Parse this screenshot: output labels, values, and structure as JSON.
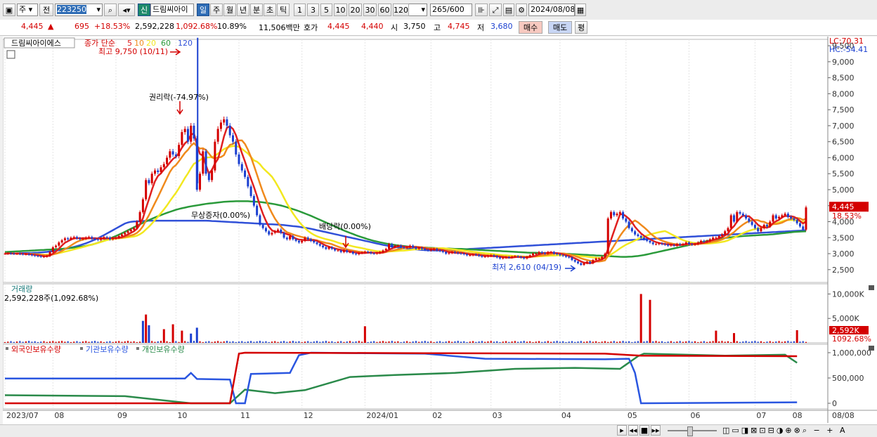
{
  "toolbar": {
    "market": "주",
    "prev_label": "전",
    "code": "223250",
    "credit_badge": "신",
    "name": "드림씨아이",
    "period_tabs": [
      "일",
      "주",
      "월",
      "년",
      "분",
      "초",
      "틱"
    ],
    "period_selected": "일",
    "interval_buttons": [
      "1",
      "3",
      "5",
      "10",
      "20",
      "30",
      "60",
      "120"
    ],
    "count": "265",
    "count_max": "/600",
    "date": "2024/08/08"
  },
  "quote": {
    "price": "4,445",
    "change": "695",
    "change_pct": "+18.53%",
    "volume": "2,592,228",
    "volume_ratio": "1,092.68%",
    "turnover": "10.89%",
    "amount": "11,506백만",
    "ask_label": "호가",
    "ask1": "4,445",
    "ask2": "4,440",
    "open_label": "시",
    "open": "3,750",
    "high_label": "고",
    "high": "4,745",
    "low_label": "저",
    "low": "3,680",
    "buy_label": "매수",
    "sell_label": "매도",
    "avg_label": "평"
  },
  "chart_data": [
    {
      "type": "line",
      "panel": "price",
      "title_label": "드림씨아이에스",
      "ma_label": "종가 단순",
      "ma_periods": [
        "5",
        "10",
        "20",
        "60",
        "120"
      ],
      "ma_colors": [
        "#e02020",
        "#f08a1c",
        "#f2e820",
        "#2a9a3a",
        "#3050d8"
      ],
      "lc": "LC:70.31",
      "hc": "HC:-54.41",
      "y_ticks": [
        "9,500",
        "9,000",
        "8,500",
        "8,000",
        "7,500",
        "7,000",
        "6,500",
        "6,000",
        "5,500",
        "5,000",
        "4,500",
        "4,000",
        "3,500",
        "3,000",
        "2,500"
      ],
      "ylim": [
        2100,
        9700
      ],
      "x_ticks": [
        "2023/07",
        "08",
        "09",
        "10",
        "11",
        "12",
        "2024/01",
        "02",
        "03",
        "04",
        "05",
        "06",
        "07",
        "08",
        "08/08"
      ],
      "last_price_label": "4,445",
      "last_change_label": "18.53%",
      "annotations": [
        "최고 9,750 (10/11)",
        "권리락(-74.97%)",
        "무상증자(0.00%)",
        "배당락(0.00%)",
        "최저 2,610 (04/19)"
      ],
      "close": [
        3000,
        3010,
        3005,
        2995,
        3000,
        2990,
        2980,
        2985,
        2970,
        2950,
        2930,
        2920,
        2900,
        2910,
        2930,
        3050,
        3200,
        3250,
        3350,
        3420,
        3480,
        3450,
        3500,
        3520,
        3480,
        3450,
        3470,
        3500,
        3520,
        3470,
        3450,
        3430,
        3480,
        3520,
        3500,
        3450,
        3480,
        3500,
        3550,
        3600,
        3650,
        3700,
        3750,
        3800,
        4000,
        4300,
        4700,
        5300,
        5200,
        5500,
        5600,
        5550,
        5700,
        5800,
        6000,
        6200,
        6100,
        6050,
        6400,
        6800,
        6900,
        6500,
        7000,
        6600,
        5000,
        5500,
        6200,
        5500,
        5300,
        5600,
        6500,
        6900,
        7100,
        7200,
        7000,
        6700,
        6500,
        6100,
        5800,
        5600,
        5400,
        5100,
        4800,
        4500,
        4200,
        3900,
        3800,
        3700,
        3600,
        3650,
        3700,
        3750,
        3650,
        3500,
        3450,
        3550,
        3450,
        3400,
        3350,
        3400,
        3500,
        3450,
        3400,
        3350,
        3300,
        3250,
        3200,
        3150,
        3200,
        3150,
        3100,
        3100,
        3050,
        3100,
        3050,
        3050,
        3000,
        2980,
        3020,
        3040,
        3060,
        3040,
        3010,
        3000,
        3020,
        3050,
        3100,
        3150,
        3300,
        3200,
        3250,
        3250,
        3200,
        3180,
        3200,
        3250,
        3200,
        3150,
        3180,
        3150,
        3120,
        3100,
        3130,
        3150,
        3100,
        3080,
        3050,
        3000,
        3020,
        3050,
        3030,
        3010,
        3000,
        2980,
        2950,
        2950,
        2970,
        2960,
        2930,
        2900,
        2910,
        2930,
        2950,
        2920,
        2880,
        2850,
        2870,
        2890,
        2880,
        2900,
        2920,
        2900,
        2880,
        2850,
        2900,
        2950,
        3000,
        3000,
        3050,
        3020,
        3000,
        3050,
        3050,
        3000,
        2980,
        2950,
        2930,
        2900,
        2880,
        2800,
        2750,
        2700,
        2650,
        2700,
        2750,
        2700,
        2800,
        2850,
        2850,
        2900,
        3000,
        4100,
        4300,
        4200,
        4250,
        4300,
        4100,
        4000,
        3800,
        3700,
        3600,
        3550,
        3500,
        3450,
        3400,
        3350,
        3300,
        3300,
        3320,
        3300,
        3280,
        3250,
        3270,
        3250,
        3300,
        3280,
        3300,
        3350,
        3300,
        3280,
        3300,
        3350,
        3400,
        3380,
        3400,
        3450,
        3500,
        3500,
        3550,
        3600,
        3700,
        3800,
        4200,
        4000,
        4300,
        4250,
        4200,
        4100,
        4000,
        3900,
        3800,
        3700,
        3800,
        3900,
        3850,
        4000,
        4200,
        4100,
        4150,
        4200,
        4250,
        4150,
        4100,
        4050,
        3950,
        3850,
        3750,
        4445
      ],
      "ma60": [
        3050,
        3060,
        3070,
        3080,
        3090,
        3100,
        3110,
        3120,
        3130,
        3140,
        3150,
        3170,
        3190,
        3210,
        3240,
        3280,
        3330,
        3390,
        3460,
        3530,
        3610,
        3700,
        3790,
        3880,
        3970,
        4050,
        4130,
        4200,
        4270,
        4330,
        4390,
        4430,
        4470,
        4500,
        4530,
        4560,
        4580,
        4600,
        4620,
        4630,
        4640,
        4640,
        4640,
        4630,
        4620,
        4600,
        4570,
        4540,
        4500,
        4450,
        4390,
        4330,
        4260,
        4190,
        4110,
        4030,
        3950,
        3870,
        3790,
        3710,
        3640,
        3570,
        3510,
        3450,
        3400,
        3360,
        3320,
        3290,
        3260,
        3240,
        3220,
        3210,
        3200,
        3190,
        3180,
        3170,
        3160,
        3160,
        3150,
        3150,
        3140,
        3130,
        3120,
        3110,
        3100,
        3090,
        3080,
        3070,
        3060,
        3050,
        3040,
        3030,
        3030,
        3020,
        3020,
        3010,
        3010,
        3000,
        2990,
        2980,
        2970,
        2960,
        2950,
        2940,
        2930,
        2920,
        2910,
        2900,
        2900,
        2910,
        2930,
        2960,
        3000,
        3040,
        3080,
        3120,
        3160,
        3200,
        3240,
        3280,
        3320,
        3360,
        3400,
        3430,
        3460,
        3490,
        3510,
        3530,
        3550,
        3560,
        3570,
        3580,
        3590,
        3600,
        3620,
        3640,
        3660,
        3680,
        3690,
        3700
      ],
      "ma120": [
        3000,
        3005,
        3010,
        3015,
        3020,
        3025,
        3035,
        3050,
        3070,
        3100,
        3130,
        3170,
        3210,
        3260,
        3320,
        3390,
        3470,
        3560,
        3660,
        3760,
        3860,
        3960,
        4000,
        4010,
        4020,
        4030,
        4030,
        4030,
        4030,
        4030,
        4030,
        4030,
        4030,
        4030,
        4030,
        4030,
        4020,
        4010,
        4000,
        3990,
        3980,
        3970,
        3960,
        3950,
        3940,
        3930,
        3920,
        3910,
        3900,
        3880,
        3860,
        3840,
        3810,
        3780,
        3740,
        3700,
        3660,
        3620,
        3580,
        3540,
        3500,
        3460,
        3420,
        3380,
        3340,
        3300,
        3260,
        3230,
        3200,
        3180,
        3160,
        3140,
        3120,
        3110,
        3100,
        3100,
        3100,
        3110,
        3120,
        3130,
        3140,
        3150,
        3160,
        3170,
        3180,
        3190,
        3200,
        3210,
        3220,
        3230,
        3240,
        3250,
        3260,
        3270,
        3280,
        3290,
        3300,
        3310,
        3320,
        3330,
        3340,
        3350,
        3360,
        3370,
        3380,
        3390,
        3400,
        3410,
        3420,
        3430,
        3440,
        3450,
        3460,
        3470,
        3480,
        3490,
        3500,
        3510,
        3520,
        3530,
        3540,
        3550,
        3560,
        3570,
        3580,
        3590,
        3600,
        3610,
        3620,
        3630,
        3640,
        3650,
        3660,
        3670,
        3680,
        3690,
        3700,
        3710,
        3720,
        3730
      ]
    },
    {
      "type": "bar",
      "panel": "volume",
      "title": "거래량",
      "label": "2,592,228주(1,092.68%)",
      "y_ticks": [
        "10,000K",
        "5,000K"
      ],
      "last_label": "2,592K",
      "last_ratio_label": "1092.68%",
      "spikes": [
        {
          "index": 46,
          "value": 4500,
          "color": "#1a3fd0"
        },
        {
          "index": 47,
          "value": 5800,
          "color": "#d40000"
        },
        {
          "index": 48,
          "value": 3600,
          "color": "#1a3fd0"
        },
        {
          "index": 53,
          "value": 2800,
          "color": "#d40000"
        },
        {
          "index": 56,
          "value": 3800,
          "color": "#d40000"
        },
        {
          "index": 59,
          "value": 2500,
          "color": "#d40000"
        },
        {
          "index": 62,
          "value": 1900,
          "color": "#1a3fd0"
        },
        {
          "index": 64,
          "value": 3100,
          "color": "#1a3fd0"
        },
        {
          "index": 120,
          "value": 3400,
          "color": "#d40000"
        },
        {
          "index": 212,
          "value": 10000,
          "color": "#d40000"
        },
        {
          "index": 215,
          "value": 8800,
          "color": "#d40000"
        },
        {
          "index": 237,
          "value": 2500,
          "color": "#d40000"
        },
        {
          "index": 243,
          "value": 2000,
          "color": "#d40000"
        },
        {
          "index": 264,
          "value": 2592,
          "color": "#d40000"
        }
      ]
    },
    {
      "type": "line",
      "panel": "holdings",
      "series": [
        {
          "name": "외국인보유수량",
          "color": "#d40000"
        },
        {
          "name": "기관보유수량",
          "color": "#2a56e0"
        },
        {
          "name": "개인보유수량",
          "color": "#2a8a4a"
        }
      ],
      "y_ticks": [
        "1,000,000",
        "500,000",
        "0"
      ],
      "foreign": [
        [
          0,
          0
        ],
        [
          75,
          0
        ],
        [
          78,
          980000
        ],
        [
          80,
          1000000
        ],
        [
          140,
          990000
        ],
        [
          200,
          980000
        ],
        [
          212,
          940000
        ],
        [
          264,
          930000
        ]
      ],
      "institution": [
        [
          0,
          490000
        ],
        [
          60,
          490000
        ],
        [
          62,
          600000
        ],
        [
          64,
          480000
        ],
        [
          75,
          470000
        ],
        [
          77,
          0
        ],
        [
          80,
          0
        ],
        [
          82,
          580000
        ],
        [
          95,
          600000
        ],
        [
          98,
          950000
        ],
        [
          102,
          1000000
        ],
        [
          140,
          980000
        ],
        [
          160,
          880000
        ],
        [
          200,
          870000
        ],
        [
          208,
          880000
        ],
        [
          210,
          600000
        ],
        [
          212,
          0
        ],
        [
          264,
          20000
        ]
      ],
      "individual": [
        [
          0,
          160000
        ],
        [
          40,
          140000
        ],
        [
          62,
          0
        ],
        [
          75,
          0
        ],
        [
          80,
          270000
        ],
        [
          90,
          200000
        ],
        [
          100,
          260000
        ],
        [
          115,
          520000
        ],
        [
          130,
          560000
        ],
        [
          150,
          600000
        ],
        [
          170,
          680000
        ],
        [
          190,
          700000
        ],
        [
          205,
          680000
        ],
        [
          211,
          930000
        ],
        [
          213,
          980000
        ],
        [
          240,
          940000
        ],
        [
          260,
          960000
        ],
        [
          264,
          800000
        ]
      ]
    }
  ]
}
